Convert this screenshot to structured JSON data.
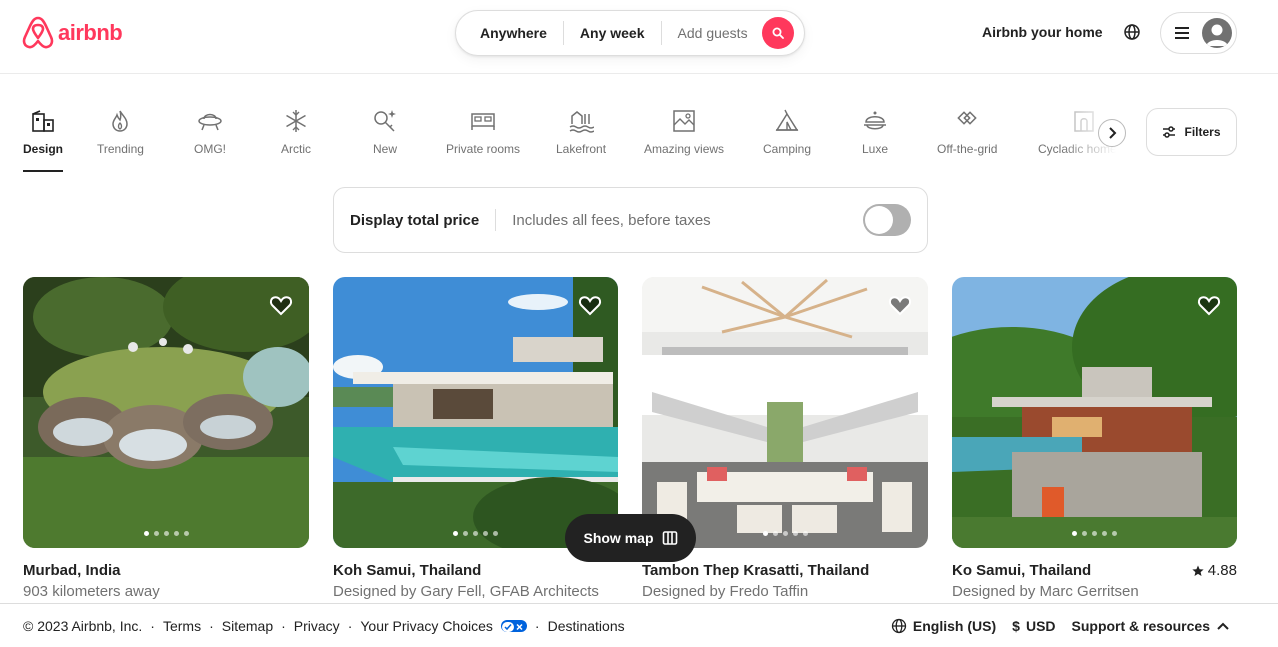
{
  "header": {
    "logo_text": "airbnb",
    "search": {
      "anywhere": "Anywhere",
      "any_week": "Any week",
      "add_guests": "Add guests"
    },
    "host_link": "Airbnb your home"
  },
  "categories": [
    {
      "label": "Design",
      "icon": "design-icon",
      "active": true
    },
    {
      "label": "Trending",
      "icon": "flame-icon"
    },
    {
      "label": "OMG!",
      "icon": "ufo-icon"
    },
    {
      "label": "Arctic",
      "icon": "snowflake-icon"
    },
    {
      "label": "New",
      "icon": "key-sparkle-icon"
    },
    {
      "label": "Private rooms",
      "icon": "bed-icon"
    },
    {
      "label": "Lakefront",
      "icon": "lake-icon"
    },
    {
      "label": "Amazing views",
      "icon": "view-icon"
    },
    {
      "label": "Camping",
      "icon": "tent-icon"
    },
    {
      "label": "Luxe",
      "icon": "luxe-icon"
    },
    {
      "label": "Off-the-grid",
      "icon": "off-grid-icon"
    },
    {
      "label": "Cycladic homes",
      "icon": "cycladic-icon"
    }
  ],
  "filters_label": "Filters",
  "price_toggle": {
    "title": "Display total price",
    "subtitle": "Includes all fees, before taxes",
    "enabled": false
  },
  "listings": [
    {
      "title": "Murbad, India",
      "subtitle": "903 kilometers away",
      "rating": ""
    },
    {
      "title": "Koh Samui, Thailand",
      "subtitle": "Designed by Gary Fell, GFAB Architects",
      "rating": ""
    },
    {
      "title": "Tambon Thep Krasatti, Thailand",
      "subtitle": "Designed by Fredo Taffin",
      "rating": ""
    },
    {
      "title": "Ko Samui, Thailand",
      "subtitle": "Designed by Marc Gerritsen",
      "rating": "4.88"
    }
  ],
  "show_map_label": "Show map",
  "footer": {
    "copyright": "© 2023 Airbnb, Inc.",
    "links": [
      "Terms",
      "Sitemap",
      "Privacy",
      "Your Privacy Choices",
      "Destinations"
    ],
    "language": "English (US)",
    "currency_symbol": "$",
    "currency": "USD",
    "support": "Support & resources"
  },
  "colors": {
    "brand": "#ff385c",
    "text": "#222222",
    "muted": "#717171"
  }
}
